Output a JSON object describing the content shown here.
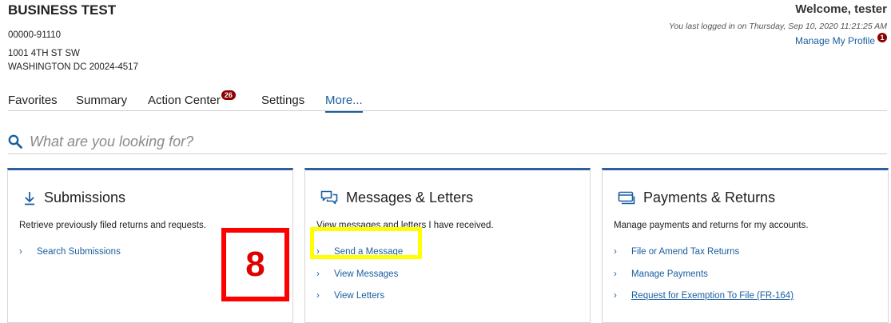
{
  "header": {
    "business_name": "BUSINESS TEST",
    "account_number": "00000-91110",
    "address_line1": "1001 4TH ST SW",
    "address_line2": "WASHINGTON DC 20024-4517",
    "welcome": "Welcome, tester",
    "last_login": "You last logged in on Thursday, Sep 10, 2020 11:21:25 AM",
    "manage_profile": "Manage My Profile",
    "profile_badge": "1"
  },
  "nav": {
    "tabs": [
      {
        "label": "Favorites"
      },
      {
        "label": "Summary"
      },
      {
        "label": "Action Center",
        "badge": "26"
      },
      {
        "label": "Settings"
      },
      {
        "label": "More...",
        "active": true
      }
    ]
  },
  "search": {
    "placeholder": "What are you looking for?"
  },
  "cards": {
    "submissions": {
      "title": "Submissions",
      "icon": "download-arrow-icon",
      "description": "Retrieve previously filed returns and requests.",
      "links": [
        "Search Submissions"
      ]
    },
    "messages": {
      "title": "Messages & Letters",
      "icon": "chat-bubbles-icon",
      "description": "View messages and letters I have received.",
      "links": [
        "Send a Message",
        "View Messages",
        "View Letters"
      ]
    },
    "payments": {
      "title": "Payments & Returns",
      "icon": "card-stack-icon",
      "description": "Manage payments and returns for my accounts.",
      "links": [
        "File or Amend Tax Returns",
        "Manage Payments",
        "Request for Exemption To File (FR-164)"
      ]
    }
  },
  "annotation": {
    "step_number": "8",
    "highlight_color": "#ffff00",
    "step_box_color": "#ff0000"
  },
  "colors": {
    "accent": "#1a5fa0",
    "badge": "#8b0000",
    "card_top_border": "#2e5f9e"
  }
}
